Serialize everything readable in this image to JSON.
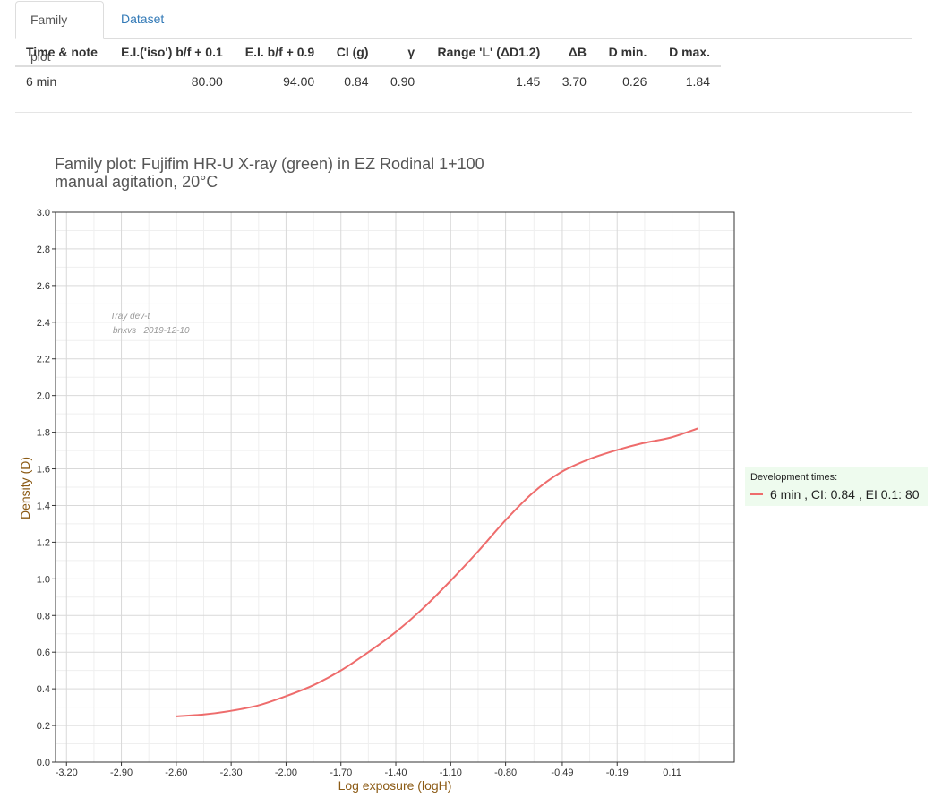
{
  "tabs": [
    {
      "label": "Family plot"
    },
    {
      "label": "Dataset"
    }
  ],
  "summary_table": {
    "headers": [
      "Time & note",
      "E.I.('iso') b/f + 0.1",
      "E.I. b/f + 0.9",
      "CI (g)",
      "γ",
      "Range 'L' (ΔD1.2)",
      "ΔB",
      "D min.",
      "D max."
    ],
    "rows": [
      [
        "6 min",
        "80.00",
        "94.00",
        "0.84",
        "0.90",
        "1.45",
        "3.70",
        "0.26",
        "1.84"
      ]
    ]
  },
  "chart_data": {
    "type": "line",
    "title": "Family plot: Fujifim HR-U X-ray (green) in EZ Rodinal 1+100",
    "subtitle": "manual agitation, 20°C",
    "xlabel": "Log exposure (logH)",
    "ylabel": "Density (D)",
    "xlim": [
      -3.26,
      0.45
    ],
    "ylim": [
      0.0,
      3.0
    ],
    "x_ticks": [
      "-3.20",
      "-2.90",
      "-2.60",
      "-2.30",
      "-2.00",
      "-1.70",
      "-1.40",
      "-1.10",
      "-0.80",
      "-0.49",
      "-0.19",
      "0.11"
    ],
    "y_ticks": [
      "0.0",
      "0.2",
      "0.4",
      "0.6",
      "0.8",
      "1.0",
      "1.2",
      "1.4",
      "1.6",
      "1.8",
      "2.0",
      "2.2",
      "2.4",
      "2.6",
      "2.8",
      "3.0"
    ],
    "grid": true,
    "annotation": [
      "Tray dev-t",
      "bnxvs   2019-12-10"
    ],
    "legend_title": "Development times:",
    "legend_position": "right",
    "series": [
      {
        "name": "6 min , CI: 0.84 , EI 0.1: 80",
        "color": "#ee6c6c",
        "x": [
          -2.6,
          -2.45,
          -2.3,
          -2.15,
          -2.0,
          -1.85,
          -1.7,
          -1.55,
          -1.4,
          -1.25,
          -1.1,
          -0.95,
          -0.8,
          -0.65,
          -0.5,
          -0.35,
          -0.2,
          -0.05,
          0.1,
          0.25
        ],
        "y": [
          0.25,
          0.26,
          0.28,
          0.31,
          0.36,
          0.42,
          0.5,
          0.6,
          0.71,
          0.84,
          0.99,
          1.15,
          1.32,
          1.47,
          1.58,
          1.65,
          1.7,
          1.74,
          1.77,
          1.82
        ]
      }
    ]
  }
}
